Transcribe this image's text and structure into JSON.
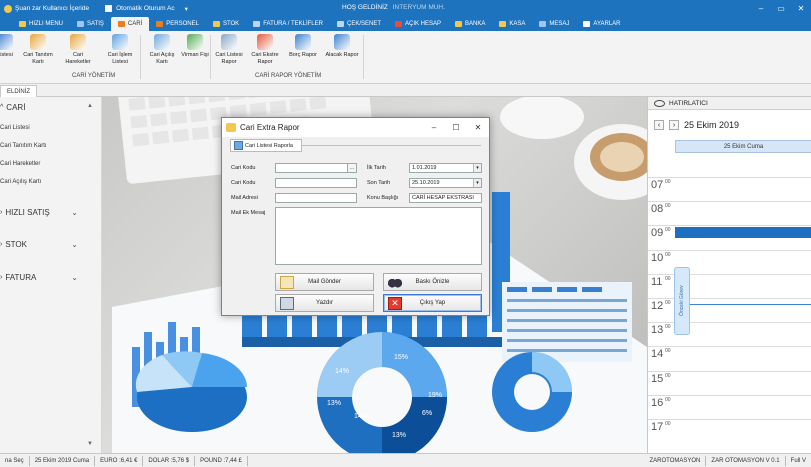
{
  "titlebar": {
    "session_text": "Şuan zar Kullanıcı İçeride",
    "auto_login": "Otomatik Oturum Ac",
    "welcome": "HOŞ GELDİNİZ",
    "user": "INTERYUM MUH.",
    "dropdown_arrow": "▾"
  },
  "menu": [
    {
      "label": "HIZLI MENU",
      "color": "#f2c94c"
    },
    {
      "label": "SATIŞ",
      "color": "#9ec6ef"
    },
    {
      "label": "CARİ",
      "color": "#e67e22"
    },
    {
      "label": "PERSONEL",
      "color": "#e67e22"
    },
    {
      "label": "STOK",
      "color": "#f2c94c"
    },
    {
      "label": "FATURA / TEKLİFLER",
      "color": "#bcd6ef"
    },
    {
      "label": "ÇEK/SENET",
      "color": "#bcd6ef"
    },
    {
      "label": "AÇIK HESAP",
      "color": "#e74c3c"
    },
    {
      "label": "BANKA",
      "color": "#f2c94c"
    },
    {
      "label": "KASA",
      "color": "#f2c94c"
    },
    {
      "label": "MESAJ",
      "color": "#9ec6ef"
    },
    {
      "label": "AYARLAR",
      "color": "#ffffff"
    }
  ],
  "ribbon": {
    "buttons": [
      {
        "label": "Listesi",
        "icon": "person-list-icon"
      },
      {
        "label": "Cari Tanıtım Kartı",
        "icon": "person-card-icon"
      },
      {
        "label": "Cari Hareketler",
        "icon": "person-activity-icon"
      },
      {
        "label": "Cari İşlem Listesi",
        "icon": "transaction-list-icon"
      },
      {
        "label": "Cari Açılış Kartı",
        "icon": "opening-card-icon"
      },
      {
        "label": "Virman Fişi",
        "icon": "transfer-icon"
      },
      {
        "label": "Cari Listesi Rapor",
        "icon": "list-report-icon"
      },
      {
        "label": "Cari Ekstre Rapor",
        "icon": "statement-chart-icon"
      },
      {
        "label": "Borç Rapor",
        "icon": "debt-report-icon"
      },
      {
        "label": "Alacak Rapor",
        "icon": "receivable-report-icon"
      }
    ],
    "group1": "CARİ YÖNETİM",
    "group2": "CARİ RAPOR YÖNETİM"
  },
  "tab": "ELDİNİZ",
  "sidebar": {
    "section1": "CARİ",
    "items": [
      "Cari Listesi",
      "Cari Tanıtım Kartı",
      "Cari Hareketler",
      "Cari Açılış Kartı"
    ],
    "section2": "HIZLI SATIŞ",
    "section3": "STOK",
    "section4": "FATURA"
  },
  "calendar": {
    "title": "HATIRLATICI",
    "date": "25 Ekim 2019",
    "day_header": "25 Ekim Cuma",
    "hours": [
      "07",
      "08",
      "09",
      "10",
      "11",
      "12",
      "13",
      "14",
      "15",
      "16",
      "17"
    ],
    "minutes": "00",
    "side_tab": "Önceki Görev"
  },
  "dialog": {
    "title": "Cari Extra Rapor",
    "tab": "Cari Listesi Raporla",
    "cari_kodu1_label": "Cari Kodu",
    "cari_kodu2_label": "Cari Kodu",
    "mail_adresi_label": "Mail Adresi",
    "mail_ek_label": "Mail Ek Mesaj",
    "ilk_tarih_label": "İlk Tarih",
    "son_tarih_label": "Son Tarih",
    "konu_label": "Konu Başlığı",
    "ilk_tarih": "1.01.2019",
    "son_tarih": "25.10.2019",
    "konu": "CARİ HESAP EKSTRASI",
    "lookup_btn": "...",
    "btn_mail": "Mail Gönder",
    "btn_print_preview": "Baskı Önizle",
    "btn_print": "Yazdır",
    "btn_exit": "Çıkış Yap"
  },
  "statusbar": {
    "theme": "na Seç",
    "date": "25 Ekim 2019 Cuma",
    "euro": "EURO :6,41 €",
    "dolar": "DOLAR :5,76 $",
    "pound": "POUND :7,44 £",
    "brand": "ZAROTOMASYON",
    "version": "ZAR OTOMASYON V 0.1",
    "full": "Full V"
  },
  "desk": {
    "pie_labels": [
      "14%",
      "15%",
      "13%",
      "19%",
      "14%",
      "6%",
      "13%"
    ]
  }
}
